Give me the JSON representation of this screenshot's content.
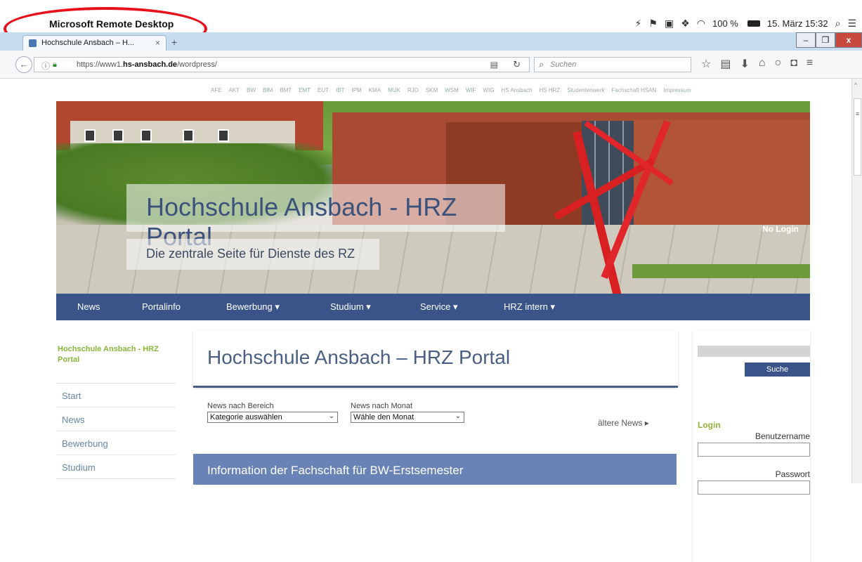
{
  "menubar": {
    "app_name": "Microsoft Remote Desktop",
    "battery": "100 %",
    "datetime": "15. März 15:32"
  },
  "browser": {
    "tab_title": "Hochschule Ansbach – H...",
    "url_prefix": "https://www1.",
    "url_domain": "hs-ansbach.de",
    "url_path": "/wordpress/",
    "search_placeholder": "Suchen"
  },
  "toplinks": [
    "AFE",
    "AKT",
    "BW",
    "BIM",
    "BMT",
    "EMT",
    "EUT",
    "IBT",
    "IPM",
    "KMA",
    "MUK",
    "RJO",
    "SKM",
    "WSM",
    "WIF",
    "WIG",
    "HS Ansbach",
    "HS HRZ",
    "Studentenwerk",
    "Fachschaft HSAN",
    "Impressum"
  ],
  "hero": {
    "title": "Hochschule Ansbach - HRZ Portal",
    "subtitle": "Die zentrale Seite für Dienste des RZ",
    "login_status": "No Login"
  },
  "mainnav": [
    "News",
    "Portalinfo",
    "Bewerbung ▾",
    "Studium ▾",
    "Service ▾",
    "HRZ intern ▾"
  ],
  "sidebar": {
    "heading": "Hochschule Ansbach - HRZ Portal",
    "items": [
      "Start",
      "News",
      "Bewerbung",
      "Studium"
    ]
  },
  "content": {
    "page_title": "Hochschule Ansbach – HRZ Portal",
    "filter_area_label": "News nach Bereich",
    "filter_area_value": "Kategorie auswählen",
    "filter_month_label": "News nach Monat",
    "filter_month_value": "Wähle den Monat",
    "older_news": "ältere News ▸",
    "info_heading": "Information der Fachschaft für BW-Erstsemester"
  },
  "right": {
    "search_button": "Suche",
    "login_heading": "Login",
    "username_label": "Benutzername",
    "password_label": "Passwort"
  }
}
